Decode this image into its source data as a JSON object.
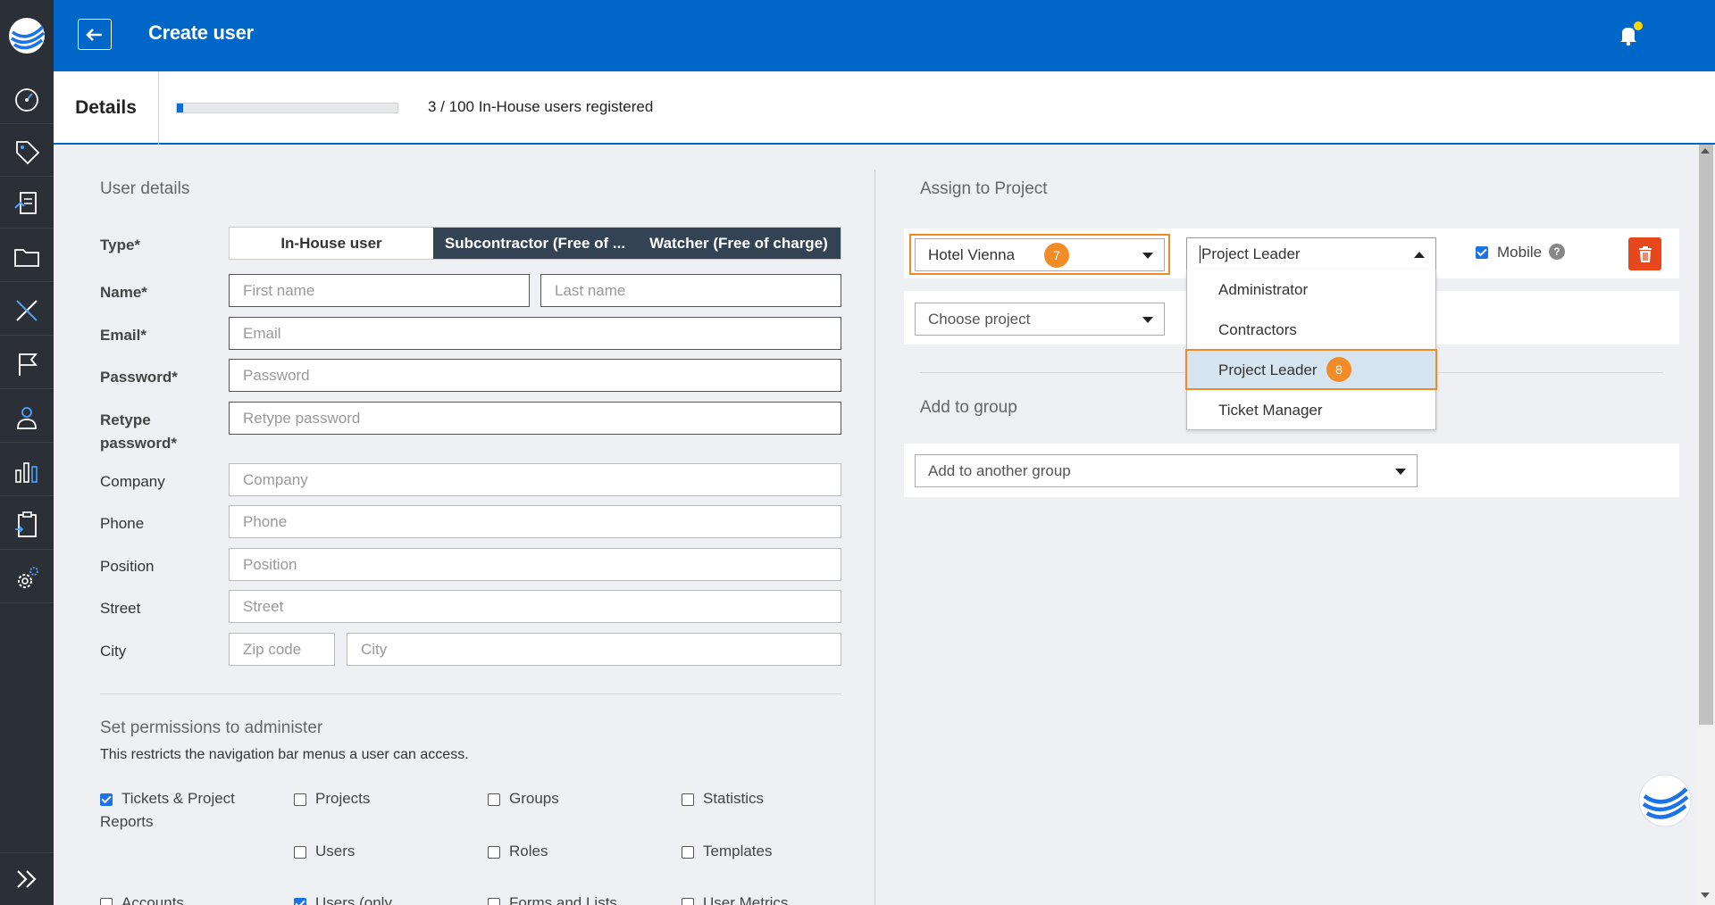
{
  "header": {
    "title": "Create user"
  },
  "tabs": {
    "details_label": "Details",
    "progress_fraction": 0.03,
    "progress_text": "3 / 100 In-House users registered"
  },
  "user_details": {
    "section_title": "User details",
    "type_label": "Type*",
    "type_options": [
      "In-House user",
      "Subcontractor (Free of ...",
      "Watcher (Free of charge)"
    ],
    "name_label": "Name*",
    "first_name_placeholder": "First name",
    "last_name_placeholder": "Last name",
    "email_label": "Email*",
    "email_placeholder": "Email",
    "password_label": "Password*",
    "password_placeholder": "Password",
    "retype_label_line1": "Retype",
    "retype_label_line2": "password*",
    "retype_placeholder": "Retype password",
    "company_label": "Company",
    "company_placeholder": "Company",
    "phone_label": "Phone",
    "phone_placeholder": "Phone",
    "position_label": "Position",
    "position_placeholder": "Position",
    "street_label": "Street",
    "street_placeholder": "Street",
    "city_label": "City",
    "zip_placeholder": "Zip code",
    "city_placeholder": "City"
  },
  "permissions": {
    "section_title": "Set permissions to administer",
    "description": "This restricts the navigation bar menus a user can access.",
    "items": [
      {
        "label_line1": "Tickets & Project",
        "label_line2": "Reports",
        "checked": true
      },
      {
        "label_line1": "Projects",
        "label_line2": "",
        "checked": false
      },
      {
        "label_line1": "Groups",
        "label_line2": "",
        "checked": false
      },
      {
        "label_line1": "Statistics",
        "label_line2": "",
        "checked": false
      },
      {
        "label_line1": "Users",
        "label_line2": "",
        "checked": false
      },
      {
        "label_line1": "Roles",
        "label_line2": "",
        "checked": false
      },
      {
        "label_line1": "Templates",
        "label_line2": "",
        "checked": false
      },
      {
        "label_line1": "Accounts",
        "label_line2": "",
        "checked": false
      },
      {
        "label_line1": "Users (only",
        "label_line2": "",
        "checked": true
      },
      {
        "label_line1": "Forms and Lists",
        "label_line2": "",
        "checked": false
      },
      {
        "label_line1": "User Metrics",
        "label_line2": "",
        "checked": false
      }
    ]
  },
  "assign_project": {
    "section_title": "Assign to Project",
    "project_value": "Hotel Vienna",
    "project_badge": "7",
    "role_value": "Project Leader",
    "mobile_label": "Mobile",
    "mobile_checked": true,
    "help_glyph": "?",
    "choose_project_placeholder": "Choose project",
    "role_options": [
      "Administrator",
      "Contractors",
      "Project Leader",
      "Ticket Manager"
    ],
    "selected_role_badge": "8"
  },
  "add_group": {
    "section_title": "Add to group",
    "placeholder": "Add to another group"
  },
  "colors": {
    "header_blue": "#0066c8",
    "sidebar_dark": "#2b3036",
    "accent_orange": "#f08a24",
    "delete_red": "#e8471c",
    "segment_dark": "#334354"
  }
}
